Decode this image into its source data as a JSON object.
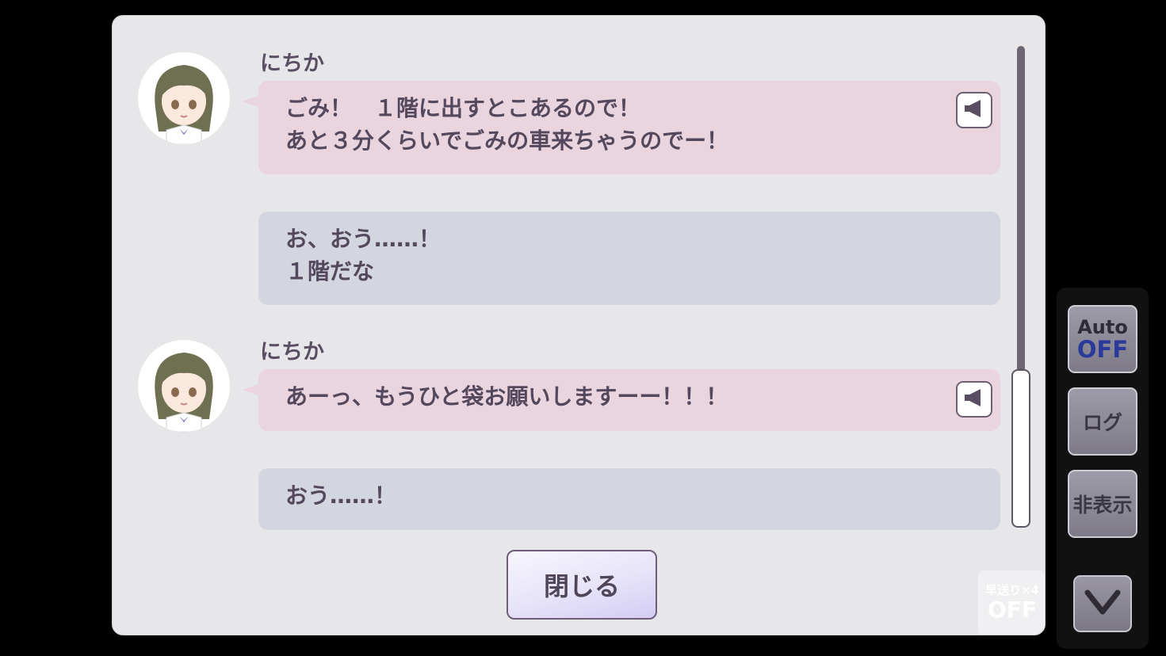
{
  "log": {
    "messages": [
      {
        "speaker": "にちか",
        "line1": "ごみ！　１階に出すとこあるので！",
        "line2": "あと３分くらいでごみの車来ちゃうのでー！"
      },
      {
        "line1": "お、おう……！",
        "line2": "１階だな"
      },
      {
        "speaker": "にちか",
        "line1": "あーっ、もうひと袋お願いしますーー！！！"
      },
      {
        "line1": "おう……！"
      }
    ],
    "close_label": "閉じる"
  },
  "fast_forward": {
    "label": "早送り×4",
    "state": "OFF"
  },
  "side_menu": {
    "auto_label": "Auto",
    "auto_state": "OFF",
    "log_label": "ログ",
    "hide_label": "非表示"
  },
  "colors": {
    "speaker_bubble": "#ead5df",
    "player_bubble": "#d3d6df",
    "auto_state": "#2b3a9a"
  },
  "icons": [
    "voice-replay-icon",
    "chevron-down-icon"
  ]
}
